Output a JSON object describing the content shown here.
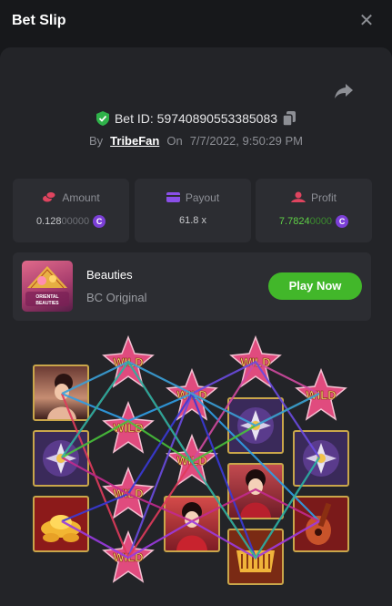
{
  "header": {
    "title": "Bet Slip",
    "close_icon": "close-icon"
  },
  "bet": {
    "id_text": "Bet ID: 59740890553385083",
    "by_label": "By",
    "user": "TribeFan",
    "on_label": "On",
    "datetime": "7/7/2022, 9:50:29 PM"
  },
  "stats": {
    "amount": {
      "label": "Amount",
      "value_bright": "0.128",
      "value_dim": "00000",
      "icon": "coins-icon",
      "color": "#e0445f"
    },
    "payout": {
      "label": "Payout",
      "value": "61.8 x",
      "icon": "card-icon",
      "color": "#8a4fe8"
    },
    "profit": {
      "label": "Profit",
      "value_bright": "7.7824",
      "value_dim": "0000",
      "icon": "profit-icon",
      "color": "#e0445f",
      "value_color": "#5fd146"
    }
  },
  "currency_symbol": "C",
  "game": {
    "name": "Beauties",
    "provider": "BC Original",
    "thumb_text": "ORIENTAL BEAUTIES",
    "play_label": "Play Now"
  },
  "wild_label": "WILD",
  "colors": {
    "accent_green": "#42b72a",
    "coin_purple": "#7b3fd6",
    "panel": "#232428",
    "card": "#2c2d32"
  }
}
